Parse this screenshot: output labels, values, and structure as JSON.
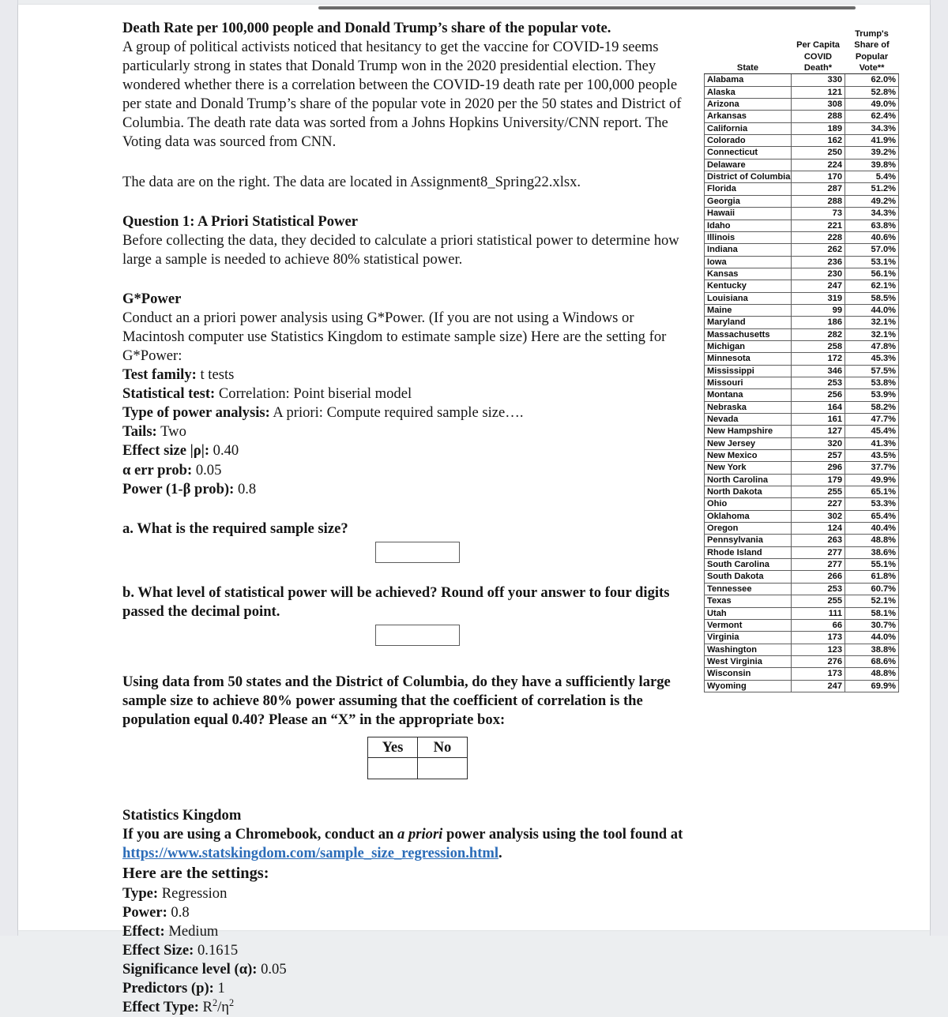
{
  "document": {
    "title_line": "Death Rate per 100,000 people and Donald Trump’s share of the popular vote.",
    "intro_paragraph": "A group of political activists noticed that hesitancy to get the vaccine for COVID-19 seems particularly strong in states that Donald Trump won in the 2020 presidential election. They wondered whether there is a correlation between the COVID-19 death rate per 100,000 people per state and Donald Trump’s share of the popular vote in 2020 per the 50 states and District of Columbia. The death rate data was sorted from a Johns Hopkins University/CNN report. The Voting data was sourced from CNN.",
    "data_location": "The data are on the right. The data are located in Assignment8_Spring22.xlsx.",
    "question1": {
      "heading": "Question 1: A Priori Statistical Power",
      "body": "Before collecting the data, they decided to calculate a priori statistical power to determine how large a sample is needed to achieve 80% statistical power."
    },
    "gpower": {
      "heading": "G*Power",
      "body": "Conduct an a priori power analysis using G*Power. (If you are not using a Windows or Macintosh computer use Statistics Kingdom to estimate sample size) Here are the setting for G*Power:",
      "settings": [
        {
          "label": "Test family",
          "sep": ":",
          "value": " t tests"
        },
        {
          "label": "Statistical test:",
          "sep": "",
          "value": " Correlation: Point biserial model"
        },
        {
          "label": "Type of power analysis:",
          "sep": "",
          "value": " A priori: Compute required sample size…."
        },
        {
          "label": "Tails:",
          "sep": "",
          "value": " Two"
        },
        {
          "label": "Effect size |ρ|:",
          "sep": "",
          "value": " 0.40"
        },
        {
          "label": "α err prob",
          "sep": ":",
          "value": " 0.05"
        },
        {
          "label": "Power (1-β prob):",
          "sep": "",
          "value": " 0.8"
        }
      ]
    },
    "question_a": "a. What is the required sample size?",
    "question_b": "b. What level of statistical power will be achieved? Round off your answer to four digits passed the decimal point.",
    "answer_a_value": "",
    "answer_b_value": "",
    "yesno_question": "Using data from 50 states and the District of Columbia, do they have a sufficiently large sample size to achieve 80% power assuming that the coefficient of correlation is the population equal 0.40? Please an “X” in the appropriate box:",
    "yesno": {
      "yes_label": "Yes",
      "no_label": "No",
      "yes_value": "",
      "no_value": ""
    },
    "statskingdom": {
      "heading": "Statistics Kingdom",
      "line_prefix": "If you are using a Chromebook, conduct an ",
      "line_italic": "a priori",
      "line_middle": " power analysis using the tool found at ",
      "link_text": "https://www.statskingdom.com/sample_size_regression.html",
      "line_suffix": ".",
      "settings_heading": "Here are the settings:",
      "settings": [
        {
          "label": "Type:",
          "value": " Regression"
        },
        {
          "label": "Power:",
          "value": " 0.8"
        },
        {
          "label": "Effect:",
          "value": " Medium"
        },
        {
          "label": "Effect Size:",
          "value": " 0.1615"
        },
        {
          "label": "Significance level (α):",
          "value": " 0.05"
        },
        {
          "label": "Predictors (p):",
          "value": " 1"
        }
      ],
      "effect_type_label": "Effect Type:",
      "effect_type_value": "R²/η²"
    }
  },
  "chart_data": {
    "type": "table",
    "title": "Per Capita COVID Death and Trump's Share of Popular Vote by State",
    "columns": [
      "State",
      "Per Capita COVID Death*",
      "Trump's Share of Popular Vote**"
    ],
    "header_lines": {
      "col1": [
        "",
        "",
        "",
        "State"
      ],
      "col2": [
        "",
        "Per Capita",
        "COVID",
        "Death*"
      ],
      "col3": [
        "Trump's",
        "Share of",
        "Popular",
        "Vote**"
      ]
    },
    "categories": [
      "Alabama",
      "Alaska",
      "Arizona",
      "Arkansas",
      "California",
      "Colorado",
      "Connecticut",
      "Delaware",
      "District of Columbia",
      "Florida",
      "Georgia",
      "Hawaii",
      "Idaho",
      "Illinois",
      "Indiana",
      "Iowa",
      "Kansas",
      "Kentucky",
      "Louisiana",
      "Maine",
      "Maryland",
      "Massachusetts",
      "Michigan",
      "Minnesota",
      "Mississippi",
      "Missouri",
      "Montana",
      "Nebraska",
      "Nevada",
      "New Hampshire",
      "New Jersey",
      "New Mexico",
      "New York",
      "North Carolina",
      "North Dakota",
      "Ohio",
      "Oklahoma",
      "Oregon",
      "Pennsylvania",
      "Rhode Island",
      "South Carolina",
      "South Dakota",
      "Tennessee",
      "Texas",
      "Utah",
      "Vermont",
      "Virginia",
      "Washington",
      "West Virginia",
      "Wisconsin",
      "Wyoming"
    ],
    "series": [
      {
        "name": "Per Capita COVID Death*",
        "values": [
          330,
          121,
          308,
          288,
          189,
          162,
          250,
          224,
          170,
          287,
          288,
          73,
          221,
          228,
          262,
          236,
          230,
          247,
          319,
          99,
          186,
          282,
          258,
          172,
          346,
          253,
          256,
          164,
          161,
          127,
          320,
          257,
          296,
          179,
          255,
          227,
          302,
          124,
          263,
          277,
          277,
          266,
          253,
          255,
          111,
          66,
          173,
          123,
          276,
          173,
          247
        ]
      },
      {
        "name": "Trump's Share of Popular Vote**",
        "values": [
          "62.0%",
          "52.8%",
          "49.0%",
          "62.4%",
          "34.3%",
          "41.9%",
          "39.2%",
          "39.8%",
          "5.4%",
          "51.2%",
          "49.2%",
          "34.3%",
          "63.8%",
          "40.6%",
          "57.0%",
          "53.1%",
          "56.1%",
          "62.1%",
          "58.5%",
          "44.0%",
          "32.1%",
          "32.1%",
          "47.8%",
          "45.3%",
          "57.5%",
          "53.8%",
          "53.9%",
          "58.2%",
          "47.7%",
          "45.4%",
          "41.3%",
          "43.5%",
          "37.7%",
          "49.9%",
          "65.1%",
          "53.3%",
          "65.4%",
          "40.4%",
          "48.8%",
          "38.6%",
          "55.1%",
          "61.8%",
          "60.7%",
          "52.1%",
          "58.1%",
          "30.7%",
          "44.0%",
          "38.8%",
          "68.6%",
          "48.8%",
          "69.9%"
        ]
      }
    ]
  }
}
